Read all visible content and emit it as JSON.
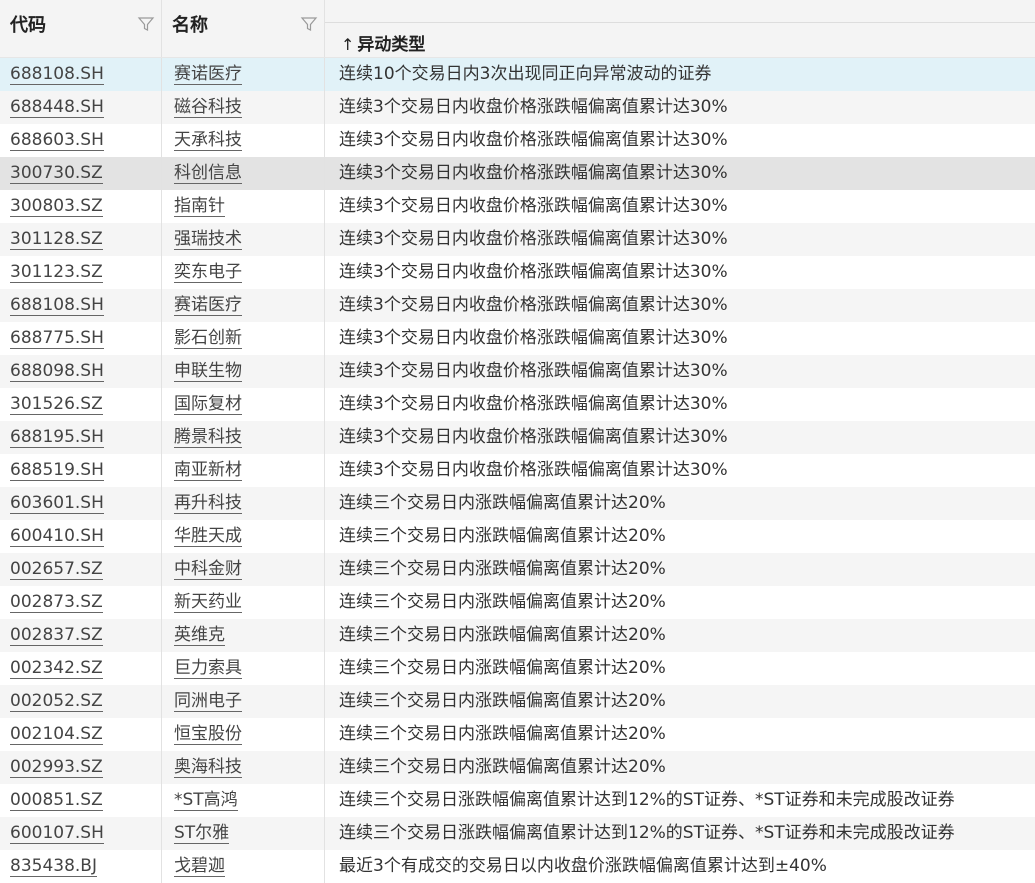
{
  "header": {
    "code_label": "代码",
    "name_label": "名称",
    "type_label": "异动类型",
    "sort_arrow": "↑"
  },
  "rows": [
    {
      "code": "688108.SH",
      "name": "赛诺医疗",
      "type": "连续10个交易日内3次出现同正向异常波动的证券"
    },
    {
      "code": "688448.SH",
      "name": "磁谷科技",
      "type": "连续3个交易日内收盘价格涨跌幅偏离值累计达30%"
    },
    {
      "code": "688603.SH",
      "name": "天承科技",
      "type": "连续3个交易日内收盘价格涨跌幅偏离值累计达30%"
    },
    {
      "code": "300730.SZ",
      "name": "科创信息",
      "type": "连续3个交易日内收盘价格涨跌幅偏离值累计达30%"
    },
    {
      "code": "300803.SZ",
      "name": "指南针",
      "type": "连续3个交易日内收盘价格涨跌幅偏离值累计达30%"
    },
    {
      "code": "301128.SZ",
      "name": "强瑞技术",
      "type": "连续3个交易日内收盘价格涨跌幅偏离值累计达30%"
    },
    {
      "code": "301123.SZ",
      "name": "奕东电子",
      "type": "连续3个交易日内收盘价格涨跌幅偏离值累计达30%"
    },
    {
      "code": "688108.SH",
      "name": "赛诺医疗",
      "type": "连续3个交易日内收盘价格涨跌幅偏离值累计达30%"
    },
    {
      "code": "688775.SH",
      "name": "影石创新",
      "type": "连续3个交易日内收盘价格涨跌幅偏离值累计达30%"
    },
    {
      "code": "688098.SH",
      "name": "申联生物",
      "type": "连续3个交易日内收盘价格涨跌幅偏离值累计达30%"
    },
    {
      "code": "301526.SZ",
      "name": "国际复材",
      "type": "连续3个交易日内收盘价格涨跌幅偏离值累计达30%"
    },
    {
      "code": "688195.SH",
      "name": "腾景科技",
      "type": "连续3个交易日内收盘价格涨跌幅偏离值累计达30%"
    },
    {
      "code": "688519.SH",
      "name": "南亚新材",
      "type": "连续3个交易日内收盘价格涨跌幅偏离值累计达30%"
    },
    {
      "code": "603601.SH",
      "name": "再升科技",
      "type": "连续三个交易日内涨跌幅偏离值累计达20%"
    },
    {
      "code": "600410.SH",
      "name": "华胜天成",
      "type": "连续三个交易日内涨跌幅偏离值累计达20%"
    },
    {
      "code": "002657.SZ",
      "name": "中科金财",
      "type": "连续三个交易日内涨跌幅偏离值累计达20%"
    },
    {
      "code": "002873.SZ",
      "name": "新天药业",
      "type": "连续三个交易日内涨跌幅偏离值累计达20%"
    },
    {
      "code": "002837.SZ",
      "name": "英维克",
      "type": "连续三个交易日内涨跌幅偏离值累计达20%"
    },
    {
      "code": "002342.SZ",
      "name": "巨力索具",
      "type": "连续三个交易日内涨跌幅偏离值累计达20%"
    },
    {
      "code": "002052.SZ",
      "name": "同洲电子",
      "type": "连续三个交易日内涨跌幅偏离值累计达20%"
    },
    {
      "code": "002104.SZ",
      "name": "恒宝股份",
      "type": "连续三个交易日内涨跌幅偏离值累计达20%"
    },
    {
      "code": "002993.SZ",
      "name": "奥海科技",
      "type": "连续三个交易日内涨跌幅偏离值累计达20%"
    },
    {
      "code": "000851.SZ",
      "name": "*ST高鸿",
      "type": "连续三个交易日涨跌幅偏离值累计达到12%的ST证券、*ST证券和未完成股改证券"
    },
    {
      "code": "600107.SH",
      "name": "ST尔雅",
      "type": "连续三个交易日涨跌幅偏离值累计达到12%的ST证券、*ST证券和未完成股改证券"
    },
    {
      "code": "835438.BJ",
      "name": "戈碧迦",
      "type": "最近3个有成交的交易日以内收盘价涨跌幅偏离值累计达到±40%"
    }
  ],
  "highlighted_rows": {
    "selected": 0,
    "hover": 3
  },
  "colors": {
    "selected_bg": "#e1f2f8",
    "hover_bg": "#e3e3e3",
    "header_bg": "#f4f4f4"
  }
}
